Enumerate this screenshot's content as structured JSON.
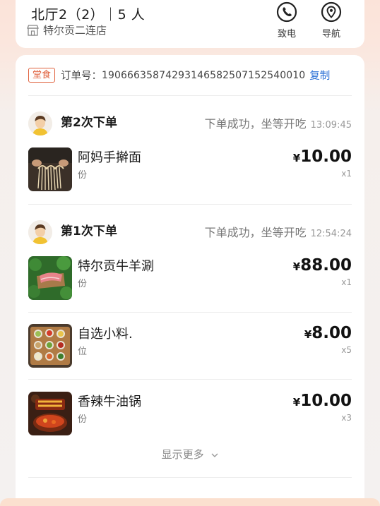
{
  "store": {
    "table_title": "北厅2（2）｜5 人",
    "name": "特尔贡二连店",
    "call_label": "致电",
    "nav_label": "导航"
  },
  "order": {
    "tag": "堂食",
    "number_label": "订单号：",
    "number": "1906663587429314658250715254001​0",
    "copy_label": "复制"
  },
  "batches": [
    {
      "title": "第2次下单",
      "status": "下单成功，坐等开吃",
      "time": "13:09:45",
      "items": [
        {
          "name": "阿妈手擀面",
          "unit": "份",
          "currency": "¥",
          "price": "10.00",
          "qty": "x1"
        }
      ]
    },
    {
      "title": "第1次下单",
      "status": "下单成功，坐等开吃",
      "time": "12:54:24",
      "items": [
        {
          "name": "特尔贡牛羊涮",
          "unit": "份",
          "currency": "¥",
          "price": "88.00",
          "qty": "x1"
        },
        {
          "name": "自选小料.",
          "unit": "位",
          "currency": "¥",
          "price": "8.00",
          "qty": "x5"
        },
        {
          "name": "香辣牛油锅",
          "unit": "份",
          "currency": "¥",
          "price": "10.00",
          "qty": "x3"
        }
      ]
    }
  ],
  "show_more_label": "显示更多",
  "colors": {
    "accent": "#e0613d",
    "link": "#2a6fd6",
    "background_top": "#fbe3d9"
  },
  "icons": [
    "store-icon",
    "phone-icon",
    "location-pin-icon",
    "chevron-down-icon"
  ]
}
